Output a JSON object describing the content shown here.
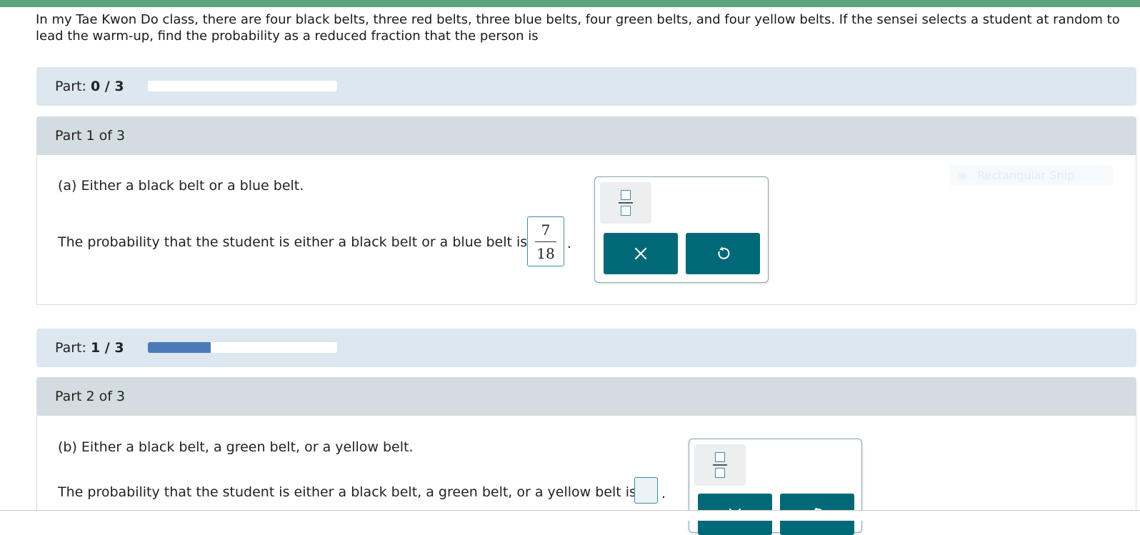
{
  "question": {
    "text": "In my Tae Kwon Do class, there are four black belts, three red belts, three blue belts, four green belts, and four yellow belts. If the sensei selects a student at random to lead the warm-up, find the probability as a reduced fraction that the person is"
  },
  "progress": [
    {
      "label": "Part:",
      "value": "0 / 3",
      "fill_fraction": 0.0
    },
    {
      "label": "Part:",
      "value": "1 / 3",
      "fill_fraction": 0.333
    }
  ],
  "parts": [
    {
      "header": "Part 1 of 3",
      "prompt": "(a) Either a black belt or a blue belt.",
      "answer_lead": "The probability that the student is either a black belt or a blue belt is",
      "answer_numerator": "7",
      "answer_denominator": "18",
      "period": "."
    },
    {
      "header": "Part 2 of 3",
      "prompt": "(b) Either a black belt, a green belt, or a yellow belt.",
      "answer_lead": "The probability that the student is either a black belt, a green belt, or a yellow belt is",
      "period": "."
    }
  ],
  "overlay": {
    "snip_label": "Rectangular Snip"
  },
  "colors": {
    "top_bar": "#5fa37e",
    "progress_bg": "#dce7f0",
    "progress_fill": "#4a7ab8",
    "part_header_bg": "#d3dde1",
    "tool_button": "#006877",
    "input_border": "#3d8fa6"
  },
  "icons": {
    "fraction_tool": "fraction-icon",
    "clear": "close-icon",
    "undo": "undo-icon"
  }
}
